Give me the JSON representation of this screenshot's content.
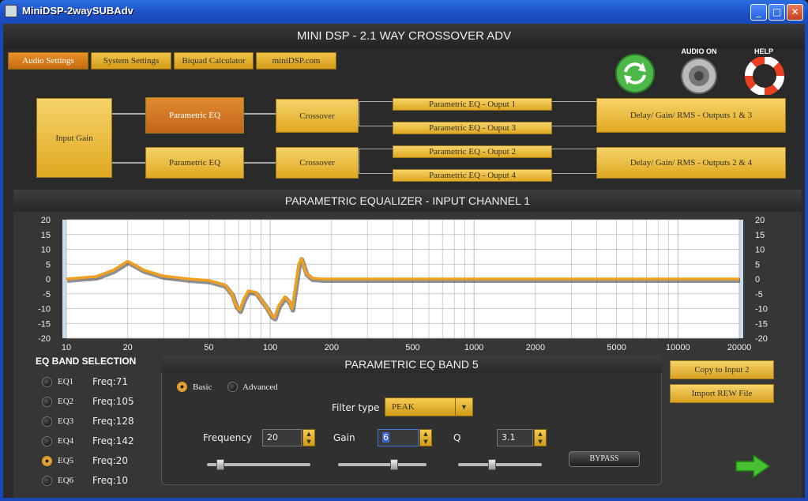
{
  "window": {
    "title": "MiniDSP-2waySUBAdv",
    "min": "_",
    "max": "□",
    "close": "✕"
  },
  "app": {
    "title": "MINI DSP - 2.1 WAY CROSSOVER ADV"
  },
  "tabs": [
    {
      "label": "Audio Settings"
    },
    {
      "label": "System Settings"
    },
    {
      "label": "Biquad Calculator"
    },
    {
      "label": "miniDSP.com"
    }
  ],
  "top_icons": {
    "audio_on": "AUDIO ON",
    "help": "HELP"
  },
  "routing": {
    "input_gain": "Input Gain",
    "peq": "Parametric EQ",
    "crossover": "Crossover",
    "peq_out1": "Parametric EQ - Ouput 1",
    "peq_out3": "Parametric EQ - Ouput 3",
    "peq_out2": "Parametric EQ - Ouput 2",
    "peq_out4": "Parametric EQ - Ouput 4",
    "delay13": "Delay/ Gain/ RMS - Outputs 1 & 3",
    "delay24": "Delay/ Gain/ RMS - Outputs 2 & 4"
  },
  "peq_panel": {
    "title": "PARAMETRIC EQUALIZER - INPUT CHANNEL 1"
  },
  "chart_data": {
    "type": "line",
    "title": "PARAMETRIC EQUALIZER - INPUT CHANNEL 1",
    "xscale": "log",
    "xlim": [
      10,
      20000
    ],
    "ylim": [
      -20,
      20
    ],
    "x_ticks": [
      "10",
      "20",
      "50",
      "100",
      "200",
      "500",
      "1000",
      "2000",
      "5000",
      "10000",
      "20000"
    ],
    "y_ticks": [
      "20",
      "15",
      "10",
      "5",
      "0",
      "-5",
      "-10",
      "-15",
      "-20"
    ],
    "series": [
      {
        "color": "#f0a020",
        "x": [
          10,
          14,
          17,
          20,
          24,
          30,
          40,
          50,
          60,
          65,
          68,
          71,
          74,
          78,
          85,
          95,
          102,
          105,
          110,
          118,
          125,
          128,
          132,
          138,
          142,
          150,
          160,
          180,
          250,
          1000,
          20000
        ],
        "y": [
          0,
          0.8,
          3,
          6,
          3,
          1,
          0,
          -0.5,
          -2,
          -5,
          -9,
          -10.5,
          -7,
          -4,
          -4.5,
          -9,
          -12.5,
          -13,
          -9,
          -6,
          -8,
          -10,
          -4,
          5,
          7,
          2,
          0.3,
          0,
          0,
          0,
          0
        ]
      }
    ]
  },
  "eq_selection": {
    "title": "EQ BAND SELECTION",
    "bands": [
      {
        "label": "EQ1",
        "freq": "Freq:71",
        "selected": false
      },
      {
        "label": "EQ2",
        "freq": "Freq:105",
        "selected": false
      },
      {
        "label": "EQ3",
        "freq": "Freq:128",
        "selected": false
      },
      {
        "label": "EQ4",
        "freq": "Freq:142",
        "selected": false
      },
      {
        "label": "EQ5",
        "freq": "Freq:20",
        "selected": true
      },
      {
        "label": "EQ6",
        "freq": "Freq:10",
        "selected": false
      }
    ]
  },
  "band_panel": {
    "title": "PARAMETRIC EQ BAND 5",
    "mode_basic": "Basic",
    "mode_advanced": "Advanced",
    "filter_type_label": "Filter type",
    "filter_type": "PEAK",
    "frequency_label": "Frequency",
    "frequency": "20",
    "gain_label": "Gain",
    "gain": "6",
    "q_label": "Q",
    "q": "3.1",
    "bypass": "BYPASS",
    "frequency_slider": 0.1,
    "gain_slider": 0.65,
    "q_slider": 0.4
  },
  "side_buttons": {
    "copy": "Copy to Input 2",
    "import": "Import REW File"
  }
}
